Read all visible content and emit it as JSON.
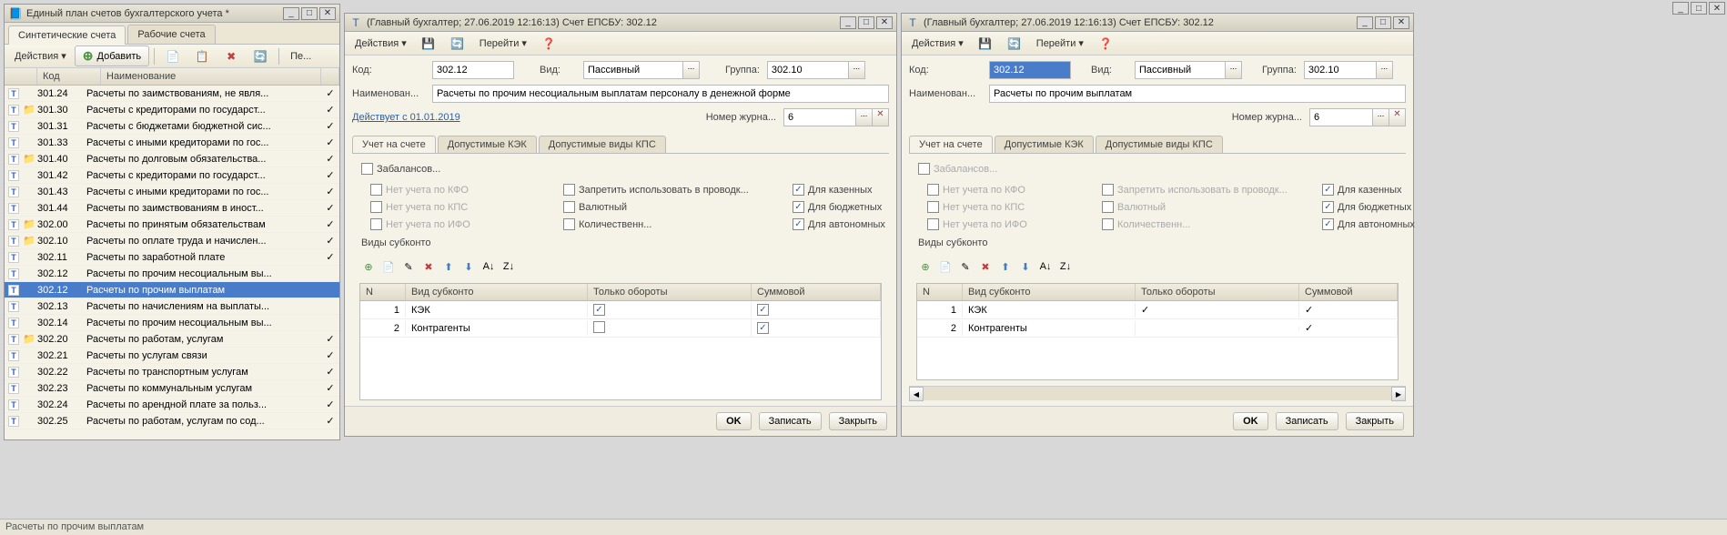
{
  "app_titlebar": {
    "min": "_",
    "max": "□",
    "close": "✕"
  },
  "main_window": {
    "title": "Единый план счетов бухгалтерского учета *",
    "tabs": [
      "Синтетические счета",
      "Рабочие счета"
    ],
    "toolbar": {
      "actions": "Действия ▾",
      "add": "Добавить",
      "more": "Пе..."
    },
    "columns": {
      "code": "Код",
      "name": "Наименование"
    },
    "rows": [
      {
        "code": "301.24",
        "name": "Расчеты по заимствованиям, не явля...",
        "folder": false,
        "checked": true
      },
      {
        "code": "301.30",
        "name": "Расчеты с кредиторами по государст...",
        "folder": true,
        "checked": true
      },
      {
        "code": "301.31",
        "name": "Расчеты с бюджетами бюджетной сис...",
        "folder": false,
        "checked": true
      },
      {
        "code": "301.33",
        "name": "Расчеты с иными кредиторами по гос...",
        "folder": false,
        "checked": true
      },
      {
        "code": "301.40",
        "name": "Расчеты по долговым обязательства...",
        "folder": true,
        "checked": true
      },
      {
        "code": "301.42",
        "name": "Расчеты с кредиторами по государст...",
        "folder": false,
        "checked": true
      },
      {
        "code": "301.43",
        "name": "Расчеты с иными кредиторами по гос...",
        "folder": false,
        "checked": true
      },
      {
        "code": "301.44",
        "name": "Расчеты по заимствованиям в иност...",
        "folder": false,
        "checked": true
      },
      {
        "code": "302.00",
        "name": "Расчеты по принятым обязательствам",
        "folder": true,
        "checked": true
      },
      {
        "code": "302.10",
        "name": "Расчеты по оплате труда и начислен...",
        "folder": true,
        "checked": true
      },
      {
        "code": "302.11",
        "name": "Расчеты по заработной плате",
        "folder": false,
        "checked": true
      },
      {
        "code": "302.12",
        "name": "Расчеты по прочим несоциальным вы...",
        "folder": false,
        "checked": false
      },
      {
        "code": "302.12",
        "name": "Расчеты по прочим выплатам",
        "folder": false,
        "checked": false,
        "selected": true
      },
      {
        "code": "302.13",
        "name": "Расчеты по начислениям на выплаты...",
        "folder": false,
        "checked": false
      },
      {
        "code": "302.14",
        "name": "Расчеты по прочим несоциальным вы...",
        "folder": false,
        "checked": false
      },
      {
        "code": "302.20",
        "name": "Расчеты по  работам, услугам",
        "folder": true,
        "checked": true
      },
      {
        "code": "302.21",
        "name": "Расчеты по услугам связи",
        "folder": false,
        "checked": true
      },
      {
        "code": "302.22",
        "name": "Расчеты по транспортным услугам",
        "folder": false,
        "checked": true
      },
      {
        "code": "302.23",
        "name": "Расчеты по коммунальным услугам",
        "folder": false,
        "checked": true
      },
      {
        "code": "302.24",
        "name": "Расчеты по арендной плате за польз...",
        "folder": false,
        "checked": true
      },
      {
        "code": "302.25",
        "name": "Расчеты по работам, услугам по сод...",
        "folder": false,
        "checked": true
      }
    ],
    "status": "Расчеты по прочим выплатам"
  },
  "detail_labels": {
    "code": "Код:",
    "kind": "Вид:",
    "group": "Группа:",
    "name": "Наименован...",
    "journal": "Номер журна...",
    "valid": "Действует с 01.01.2019",
    "tabs": [
      "Учет на счете",
      "Допустимые КЭК",
      "Допустимые виды КПС"
    ],
    "offbalance": "Забалансов...",
    "cb": {
      "no_kfo": "Нет учета по КФО",
      "no_kps": "Нет учета по КПС",
      "no_ifo": "Нет учета по ИФО",
      "forbid": "Запретить использовать в проводк...",
      "currency": "Валютный",
      "qty": "Количественн...",
      "state": "Для казенных",
      "budget": "Для бюджетных",
      "auto": "Для автономных"
    },
    "subkonto_header": "Виды субконто",
    "cols": {
      "n": "N",
      "kind": "Вид субконто",
      "turnover": "Только обороты",
      "sum": "Суммовой"
    },
    "buttons": {
      "ok": "OK",
      "save": "Записать",
      "close": "Закрыть"
    },
    "goto": "Перейти ▾",
    "actions": "Действия ▾"
  },
  "detail1": {
    "title": "(Главный бухгалтер; 27.06.2019 12:16:13) Счет ЕПСБУ: 302.12",
    "code": "302.12",
    "kind": "Пассивный",
    "group": "302.10",
    "name": "Расчеты по прочим несоциальным выплатам персоналу в денежной форме",
    "journal": "6",
    "cb_state": true,
    "cb_budget": true,
    "cb_auto": true,
    "rows": [
      {
        "n": "1",
        "kind": "КЭК",
        "turnover": true,
        "sum": true
      },
      {
        "n": "2",
        "kind": "Контрагенты",
        "turnover": false,
        "sum": true
      }
    ]
  },
  "detail2": {
    "title": "(Главный бухгалтер; 27.06.2019 12:16:13) Счет ЕПСБУ: 302.12",
    "code": "302.12",
    "kind": "Пассивный",
    "group": "302.10",
    "name": "Расчеты по прочим выплатам",
    "journal": "6",
    "cb_state": true,
    "cb_budget": true,
    "cb_auto": true,
    "rows": [
      {
        "n": "1",
        "kind": "КЭК",
        "turnover": true,
        "sum": true
      },
      {
        "n": "2",
        "kind": "Контрагенты",
        "turnover": false,
        "sum": true
      }
    ]
  }
}
